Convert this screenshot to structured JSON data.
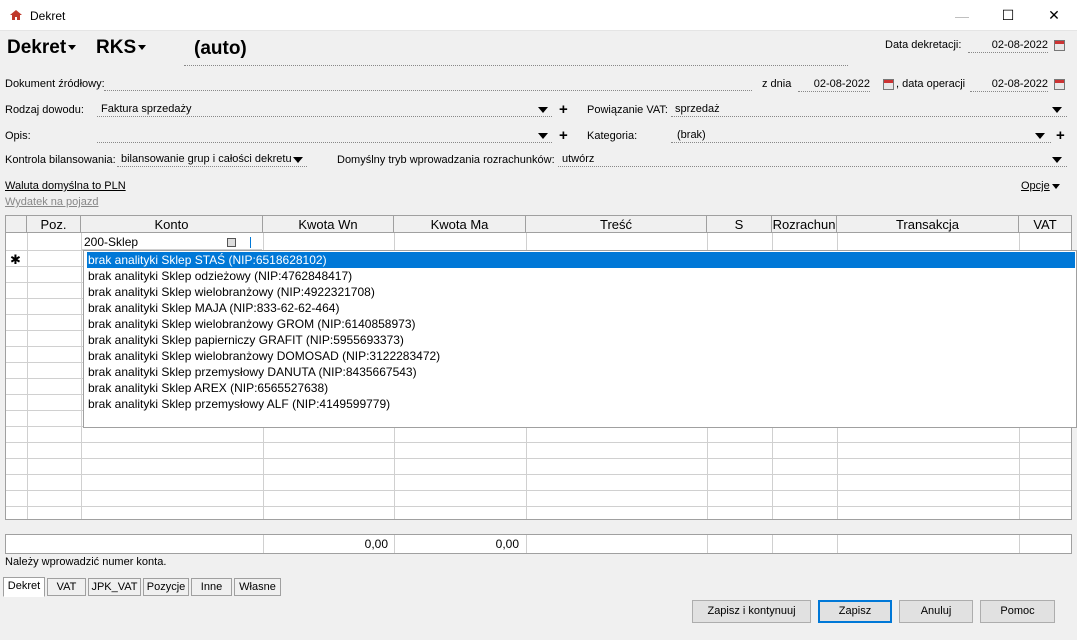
{
  "window": {
    "title": "Dekret",
    "minimize": "—",
    "maximize": "☐",
    "close": "✕"
  },
  "header": {
    "doc_type": "Dekret",
    "register": "RKS",
    "number": "(auto)",
    "data_dekretacji_label": "Data dekretacji:",
    "data_dekretacji": "02-08-2022"
  },
  "form": {
    "dokument_zrodlowy_label": "Dokument źródłowy:",
    "z_dnia_label": "z dnia",
    "z_dnia": "02-08-2022",
    "data_operacji_label": ", data operacji",
    "data_operacji": "02-08-2022",
    "rodzaj_dowodu_label": "Rodzaj dowodu:",
    "rodzaj_dowodu": "Faktura sprzedaży",
    "powiazanie_vat_label": "Powiązanie VAT:",
    "powiazanie_vat": "sprzedaż",
    "opis_label": "Opis:",
    "opis": "",
    "kategoria_label": "Kategoria:",
    "kategoria": "(brak)",
    "kontrola_label": "Kontrola bilansowania:",
    "kontrola": "bilansowanie grup i całości dekretu",
    "tryb_label": "Domyślny tryb wprowadzania rozrachunków:",
    "tryb": "utwórz",
    "waluta_link": "Waluta domyślna to PLN",
    "wydatek_link": "Wydatek na pojazd",
    "opcje": "Opcje"
  },
  "grid": {
    "columns": [
      "Poz.",
      "Konto",
      "Kwota Wn",
      "Kwota Ma",
      "Treść",
      "S",
      "Rozrachun",
      "Transakcja",
      "VAT"
    ],
    "new_row_marker": "✱",
    "konto_input": "200-Sklep",
    "sum_wn": "0,00",
    "sum_ma": "0,00"
  },
  "dropdown": {
    "items": [
      "brak analityki Sklep STAŚ  (NIP:6518628102)",
      "brak analityki Sklep odzieżowy  (NIP:4762848417)",
      "brak analityki Sklep wielobranżowy  (NIP:4922321708)",
      "brak analityki Sklep MAJA  (NIP:833-62-62-464)",
      "brak analityki Sklep wielobranżowy GROM  (NIP:6140858973)",
      "brak analityki Sklep papierniczy GRAFIT  (NIP:5955693373)",
      "brak analityki Sklep wielobranżowy DOMOSAD  (NIP:3122283472)",
      "brak analityki Sklep przemysłowy DANUTA  (NIP:8435667543)",
      "brak analityki Sklep AREX  (NIP:6565527638)",
      "brak analityki Sklep przemysłowy ALF  (NIP:4149599779)"
    ]
  },
  "status": "Należy wprowadzić numer konta.",
  "tabs": [
    "Dekret",
    "VAT",
    "JPK_VAT",
    "Pozycje",
    "Inne",
    "Własne"
  ],
  "buttons": {
    "save_continue": "Zapisz i kontynuuj",
    "save": "Zapisz",
    "cancel": "Anuluj",
    "help": "Pomoc"
  }
}
